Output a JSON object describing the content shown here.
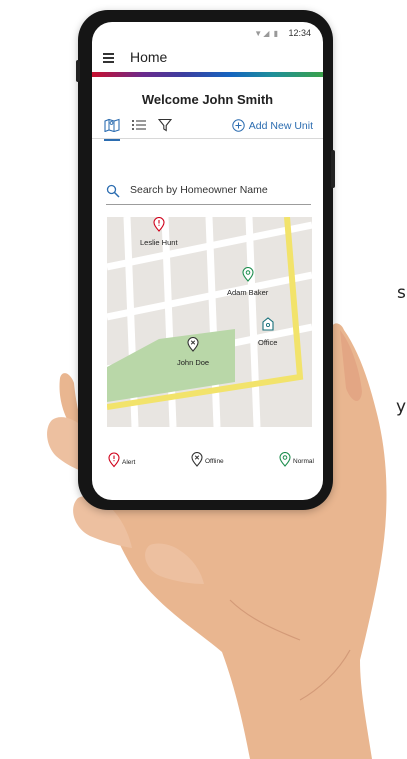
{
  "background": {
    "letter_s": "s",
    "letter_y": "y"
  },
  "status_bar": {
    "time": "12:34",
    "icons": "▼◢ ▮"
  },
  "app_bar": {
    "title": "Home",
    "menu_icon": "menu-icon"
  },
  "welcome": "Welcome John Smith",
  "toolbar": {
    "views": [
      "map-view-icon",
      "list-view-icon",
      "filter-icon"
    ],
    "add_unit_label": "Add New Unit"
  },
  "search": {
    "placeholder": "Search by Homeowner Name"
  },
  "map": {
    "markers": [
      {
        "label": "Leslie Hunt",
        "status": "alert"
      },
      {
        "label": "Adam Baker",
        "status": "normal"
      },
      {
        "label": "Office",
        "status": "office"
      },
      {
        "label": "John Doe",
        "status": "offline"
      }
    ]
  },
  "legend": [
    {
      "label": "Alert",
      "color": "#d0021b"
    },
    {
      "label": "Offline",
      "color": "#333333"
    },
    {
      "label": "Normal",
      "color": "#1e8e4e"
    }
  ],
  "colors": {
    "accent": "#2b6cb0",
    "alert": "#d0021b",
    "normal": "#1e8e4e",
    "office": "#17707a"
  }
}
